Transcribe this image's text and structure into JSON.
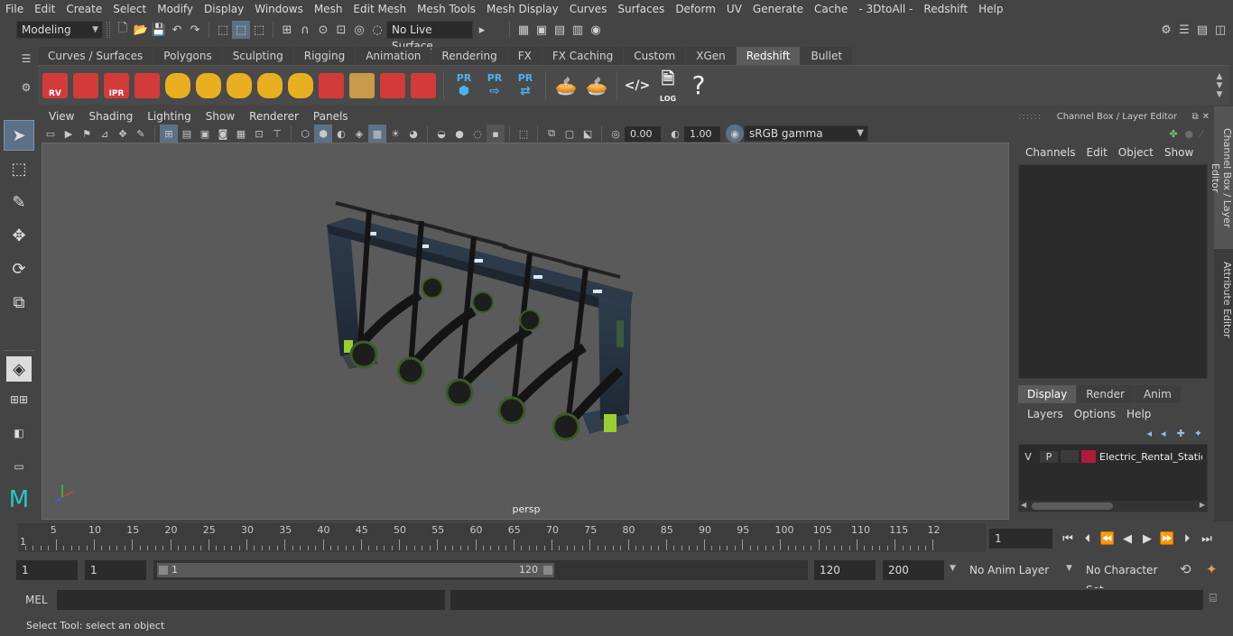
{
  "menubar": [
    "File",
    "Edit",
    "Create",
    "Select",
    "Modify",
    "Display",
    "Windows",
    "Mesh",
    "Edit Mesh",
    "Mesh Tools",
    "Mesh Display",
    "Curves",
    "Surfaces",
    "Deform",
    "UV",
    "Generate",
    "Cache",
    "- 3DtoAll -",
    "Redshift",
    "Help"
  ],
  "statusline": {
    "mode": "Modeling",
    "live_surface": "No Live Surface"
  },
  "shelf": {
    "tabs": [
      "Curves / Surfaces",
      "Polygons",
      "Sculpting",
      "Rigging",
      "Animation",
      "Rendering",
      "FX",
      "FX Caching",
      "Custom",
      "XGen",
      "Redshift",
      "Bullet"
    ],
    "active": "Redshift",
    "buttons": [
      {
        "name": "rs-render-view",
        "label": "RV",
        "color": "#d33a3a"
      },
      {
        "name": "rs-batch-render",
        "label": "",
        "color": "#d33a3a"
      },
      {
        "name": "rs-ipr",
        "label": "IPR",
        "color": "#d33a3a"
      },
      {
        "name": "rs-render-settings",
        "label": "",
        "color": "#d33a3a"
      },
      {
        "name": "rs-area-light",
        "label": "",
        "color": "#e8b020"
      },
      {
        "name": "rs-portal-light",
        "label": "",
        "color": "#e8b020"
      },
      {
        "name": "rs-spot-light",
        "label": "",
        "color": "#e8b020"
      },
      {
        "name": "rs-dome-light",
        "label": "",
        "color": "#e8b020"
      },
      {
        "name": "rs-sun-sky",
        "label": "",
        "color": "#e8b020"
      },
      {
        "name": "rs-proxy",
        "label": "",
        "color": "#d33a3a"
      },
      {
        "name": "rs-hair",
        "label": "",
        "color": "#c99a4a"
      },
      {
        "name": "rs-volume",
        "label": "",
        "color": "#d33a3a"
      },
      {
        "name": "rs-sphere",
        "label": "",
        "color": "#d33a3a"
      }
    ],
    "pr_labels": [
      "PR",
      "PR",
      "PR"
    ],
    "log_label": "LOG",
    "help_label": "?"
  },
  "viewport": {
    "menu": [
      "View",
      "Shading",
      "Lighting",
      "Show",
      "Renderer",
      "Panels"
    ],
    "exposure": "0.00",
    "gamma": "1.00",
    "color_space": "sRGB gamma",
    "camera": "persp"
  },
  "channel_box": {
    "title": "Channel Box / Layer Editor",
    "menu": [
      "Channels",
      "Edit",
      "Object",
      "Show"
    ],
    "layer_tabs": [
      "Display",
      "Render",
      "Anim"
    ],
    "layer_menu": [
      "Layers",
      "Options",
      "Help"
    ],
    "layer": {
      "v": "V",
      "p": "P",
      "color": "#b01a3a",
      "name": "Electric_Rental_Station"
    }
  },
  "side_tabs": [
    "Channel Box / Layer Editor",
    "Attribute Editor"
  ],
  "timeslider": {
    "labels": [
      "5",
      "10",
      "15",
      "20",
      "25",
      "30",
      "35",
      "40",
      "45",
      "50",
      "55",
      "60",
      "65",
      "70",
      "75",
      "80",
      "85",
      "90",
      "95",
      "100",
      "105",
      "110",
      "115",
      "12"
    ],
    "current_marker": "1",
    "current_frame": "1"
  },
  "range": {
    "start": "1",
    "playback_start": "1",
    "slider_start": "1",
    "slider_end": "120",
    "playback_end": "120",
    "end": "200",
    "anim_layer": "No Anim Layer",
    "character_set": "No Character Set"
  },
  "cmdline": {
    "label": "MEL"
  },
  "helpline": {
    "text": "Select Tool: select an object"
  }
}
